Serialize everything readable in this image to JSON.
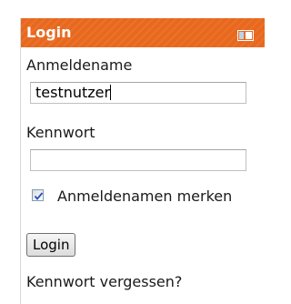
{
  "login": {
    "title": "Login",
    "username_label": "Anmeldename",
    "username_value": "testnutzer",
    "password_label": "Kennwort",
    "password_value": "",
    "remember_label": "Anmeldenamen merken",
    "remember_checked": true,
    "button_label": "Login",
    "forgot_label": "Kennwort vergessen?"
  },
  "theme": {
    "header_color": "#e8681d",
    "header_text_color": "#ffffff",
    "toggle_icon": "panel-toggle-icon"
  }
}
